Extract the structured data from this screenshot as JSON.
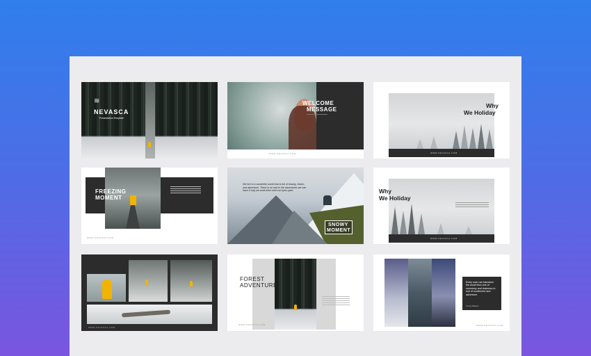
{
  "slides": {
    "s1": {
      "brand": "NEVASCA",
      "subtitle": "Presentation Template"
    },
    "s2": {
      "title_1": "WELCOME",
      "title_2": "MESSAGE",
      "footer": "WWW.NEVASCA.COM"
    },
    "s3": {
      "title_1": "Why",
      "title_2": "We Holiday",
      "footer": "WWW.NEVASCA.COM"
    },
    "s4": {
      "title_1": "FREEZING",
      "title_2": "MOMENT",
      "footer": "WWW.NEVASCA.COM"
    },
    "s5": {
      "quote": "We live in a wonderful world that is full of beauty, charm, and adventure. There is no end to the adventures we can have if only we seek them with our eyes open.",
      "title_1": "SNOWY",
      "title_2": "MOMENT"
    },
    "s6": {
      "title_1": "Why",
      "title_2": "We Holiday",
      "footer": "WWW.NEVASCA.COM"
    },
    "s7": {
      "footer": "WWW.NEVASCA.COM"
    },
    "s8": {
      "title_1": "FOREST",
      "title_2": "ADVENTURE",
      "footer": "WWW.NEVASCA.COM"
    },
    "s9": {
      "quote": "Every man can transform the world from one of monotony and drabness to one of excitement and adventure.",
      "author": "Irving Wallace",
      "footer": "WWW.NEVASCA.COM"
    }
  }
}
